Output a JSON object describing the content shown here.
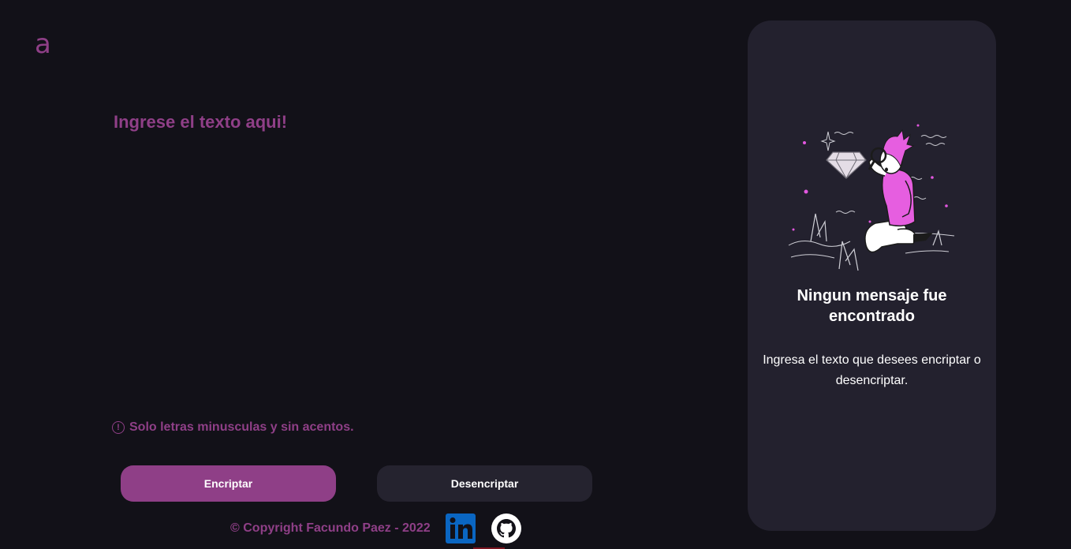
{
  "logo": {
    "glyph": "a",
    "icon": "alura-logo-icon",
    "color": "#8f3f87"
  },
  "input": {
    "placeholder": "Ingrese el texto aqui!",
    "value": ""
  },
  "hint": {
    "icon": "exclamation-circle-icon",
    "text": "Solo letras minusculas y sin acentos."
  },
  "buttons": {
    "encrypt_label": "Encriptar",
    "decrypt_label": "Desencriptar"
  },
  "footer": {
    "copyright": "© Copyright Facundo Paez - 2022",
    "linkedin_icon": "linkedin-icon",
    "github_icon": "github-icon"
  },
  "result_panel": {
    "title": "Ningun mensaje fue encontrado",
    "text": "Ingresa el texto que desees encriptar o desencriptar.",
    "illustration": "person-with-magnifying-glass-illustration"
  },
  "colors": {
    "background": "#121118",
    "accent": "#8f3f87",
    "panel": "#23212e",
    "secondary_button": "#25232f",
    "text": "#ffffff"
  }
}
